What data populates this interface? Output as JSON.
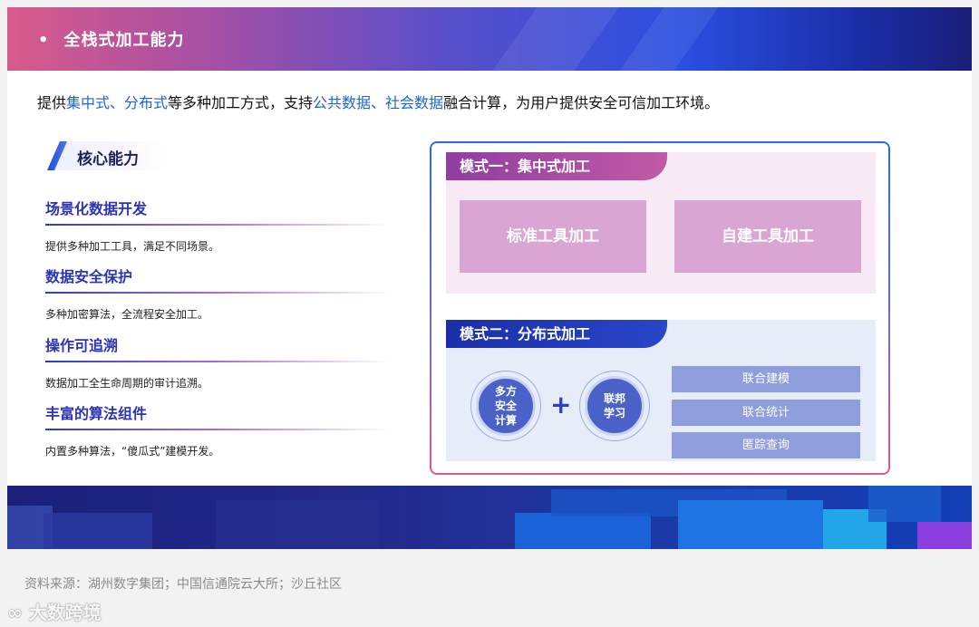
{
  "banner": {
    "title": "全栈式加工能力",
    "bullet": "•"
  },
  "intro": {
    "p1": "提供",
    "h1": "集中式、分布式",
    "p2": "等多种加工方式，支持",
    "h2": "公共数据、社会数据",
    "p3": "融合计算，为用户提供安全可信加工环境。"
  },
  "core": {
    "title": "核心能力",
    "items": [
      {
        "title": "场景化数据开发",
        "desc": "提供多种加工工具，满足不同场景。"
      },
      {
        "title": "数据安全保护",
        "desc": "多种加密算法，全流程安全加工。"
      },
      {
        "title": "操作可追溯",
        "desc": "数据加工全生命周期的审计追溯。"
      },
      {
        "title": "丰富的算法组件",
        "desc": "内置多种算法，“傻瓜式”建模开发。"
      }
    ]
  },
  "mode1": {
    "title": "模式一：集中式加工",
    "tools": [
      "标准工具加工",
      "自建工具加工"
    ]
  },
  "mode2": {
    "title": "模式二：分布式加工",
    "circle1": "多方\n安全\n计算",
    "plus": "+",
    "circle2": "联邦\n学习",
    "fed": [
      "联合建模",
      "联合统计",
      "匿踪查询"
    ]
  },
  "source": "资料来源：湖州数字集团；中国信通院云大所；沙丘社区",
  "watermark": "大数跨境",
  "colors": {
    "accent": "#1d63d8",
    "mode1": "#8f3ea0",
    "mode2": "#1b2ea8"
  }
}
